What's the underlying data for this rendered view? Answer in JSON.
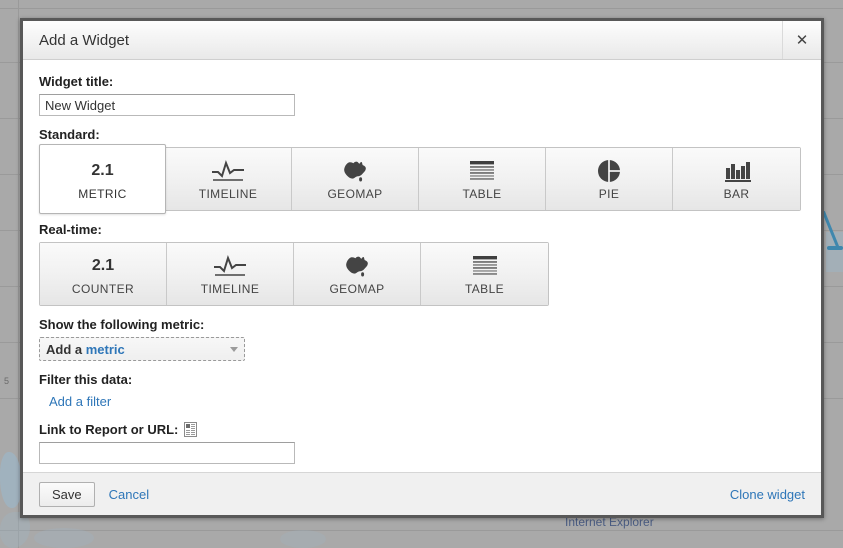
{
  "background": {
    "scale_label": "5",
    "behind_text": "Internet Explorer"
  },
  "dialog": {
    "title": "Add a Widget",
    "close_icon": "close-icon",
    "close_label": "✕"
  },
  "form": {
    "widget_title": {
      "label": "Widget title:",
      "value": "New Widget",
      "placeholder": ""
    },
    "standard": {
      "label": "Standard:",
      "selected": "METRIC",
      "options": [
        {
          "label": "METRIC",
          "icon": "metric-number-icon",
          "glyph": "2.1"
        },
        {
          "label": "TIMELINE",
          "icon": "timeline-sparkline-icon",
          "glyph": ""
        },
        {
          "label": "GEOMAP",
          "icon": "geomap-australia-icon",
          "glyph": ""
        },
        {
          "label": "TABLE",
          "icon": "table-rows-icon",
          "glyph": ""
        },
        {
          "label": "PIE",
          "icon": "pie-chart-icon",
          "glyph": ""
        },
        {
          "label": "BAR",
          "icon": "bar-chart-icon",
          "glyph": ""
        }
      ]
    },
    "realtime": {
      "label": "Real-time:",
      "selected": "",
      "options": [
        {
          "label": "COUNTER",
          "icon": "counter-number-icon",
          "glyph": "2.1"
        },
        {
          "label": "TIMELINE",
          "icon": "timeline-sparkline-icon",
          "glyph": ""
        },
        {
          "label": "GEOMAP",
          "icon": "geomap-australia-icon",
          "glyph": ""
        },
        {
          "label": "TABLE",
          "icon": "table-rows-icon",
          "glyph": ""
        }
      ]
    },
    "metric": {
      "label": "Show the following metric:",
      "prefix": "Add a ",
      "accent": "metric"
    },
    "filter": {
      "label": "Filter this data:",
      "add_link": "Add a filter"
    },
    "link": {
      "label": "Link to Report or URL:",
      "icon": "report-picker-icon",
      "value": "",
      "placeholder": ""
    }
  },
  "footer": {
    "save_label": "Save",
    "cancel_label": "Cancel",
    "clone_label": "Clone widget"
  },
  "colors": {
    "accent_blue": "#2e76b8",
    "dialog_border": "#585858",
    "page_backdrop": "#a9a9a9"
  }
}
